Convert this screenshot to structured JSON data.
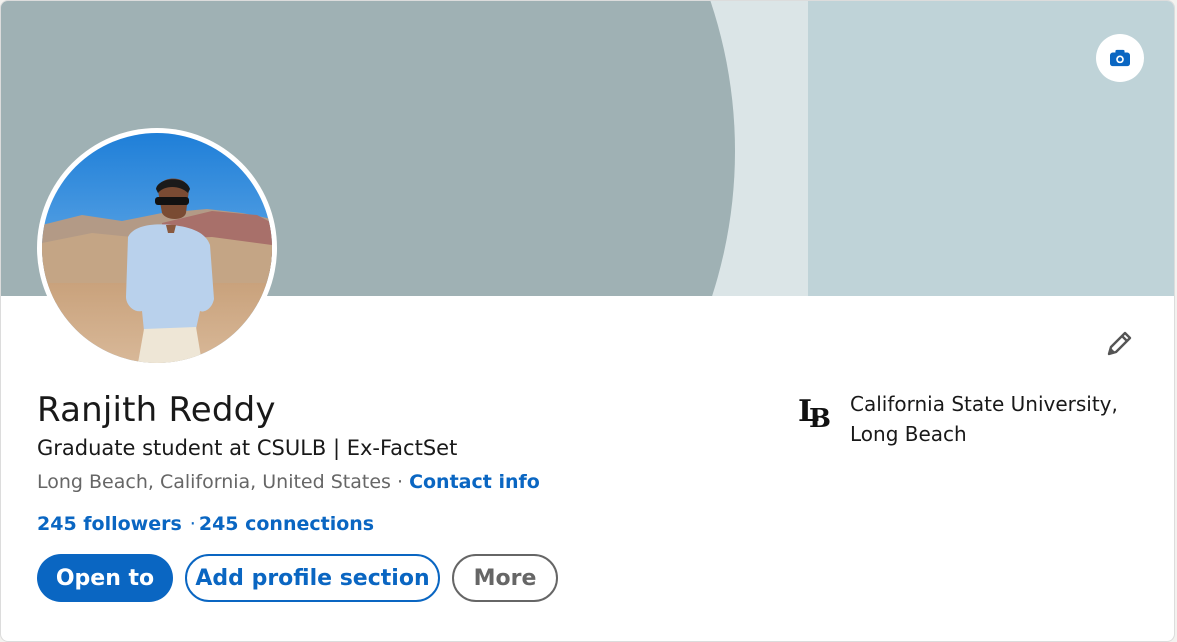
{
  "profile": {
    "name": "Ranjith Reddy",
    "headline": "Graduate student at CSULB | Ex-FactSet",
    "location": "Long Beach, California, United States",
    "location_separator": "·",
    "contact_info": "Contact info",
    "followers": "245 followers",
    "network_separator": "·",
    "connections": "245 connections"
  },
  "actions": {
    "open_to": "Open to",
    "add_profile_section": "Add profile section",
    "more": "More"
  },
  "education": {
    "school_line1": "California State University,",
    "school_line2": "Long Beach"
  },
  "icons": {
    "camera": "camera-icon",
    "edit": "pencil-icon",
    "school_logo": "lb-logo"
  },
  "colors": {
    "brand_blue": "#0a66c2",
    "text_primary": "#191919",
    "text_secondary": "#666666",
    "banner_dark": "#9fb1b4",
    "banner_light": "#bfd3d8"
  }
}
